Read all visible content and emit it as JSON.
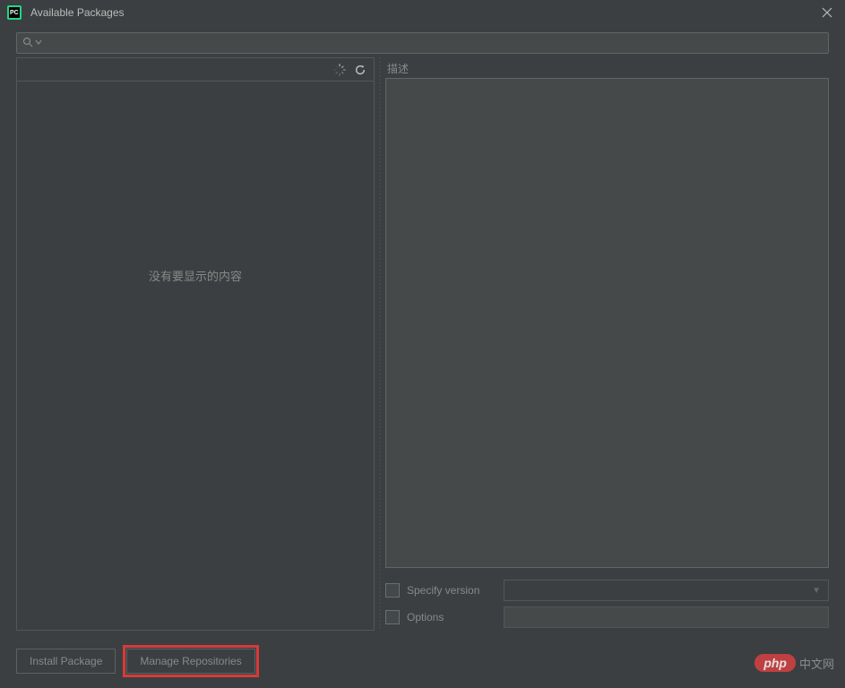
{
  "titlebar": {
    "title": "Available Packages"
  },
  "search": {
    "placeholder": ""
  },
  "leftPanel": {
    "emptyText": "没有要显示的内容"
  },
  "rightPanel": {
    "descLabel": "描述",
    "specifyVersion": {
      "label": "Specify version",
      "checked": false,
      "value": ""
    },
    "options": {
      "label": "Options",
      "checked": false,
      "value": ""
    }
  },
  "buttons": {
    "installPackage": "Install Package",
    "manageRepositories": "Manage Repositories"
  },
  "watermark": {
    "badge": "php",
    "text": "中文网"
  }
}
